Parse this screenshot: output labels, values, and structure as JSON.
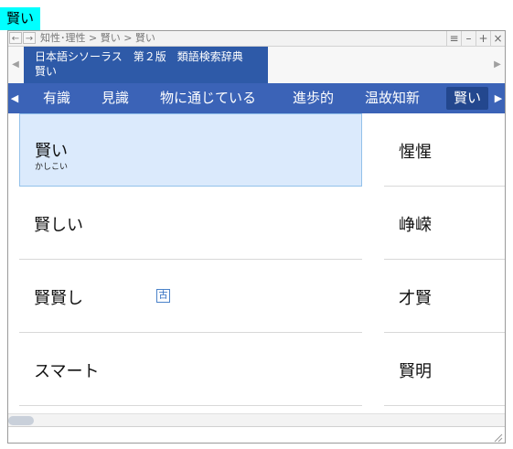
{
  "window_label": "賢い",
  "titlebar": {
    "back_icon": "left-arrow-icon",
    "forward_icon": "right-arrow-icon",
    "breadcrumb": "知性･理性 > 賢い > 賢い",
    "buttons": [
      "list-icon",
      "minimize-icon",
      "maximize-icon",
      "close-icon"
    ]
  },
  "header": {
    "dictionary_name": "日本語シソーラス　第２版　類語検索辞典",
    "current_word": "賢い"
  },
  "nav": {
    "items": [
      "有識",
      "見識",
      "物に通じている",
      "進歩的",
      "温故知新",
      "賢い"
    ],
    "active": "賢い"
  },
  "entries_left": [
    {
      "word": "賢い",
      "reading": "かしこい",
      "selected": true
    },
    {
      "word": "賢しい",
      "reading": ""
    },
    {
      "word": "賢賢し",
      "reading": "",
      "badge": "古"
    },
    {
      "word": "スマート",
      "reading": ""
    }
  ],
  "entries_right": [
    {
      "word": "惺惺"
    },
    {
      "word": "峥嵘"
    },
    {
      "word": "才賢"
    },
    {
      "word": "賢明"
    }
  ],
  "colors": {
    "accent": "#3b63b7",
    "header_dark": "#2e5aa8",
    "selected_bg": "#dbeafc",
    "tag_bg": "#00ffff"
  }
}
